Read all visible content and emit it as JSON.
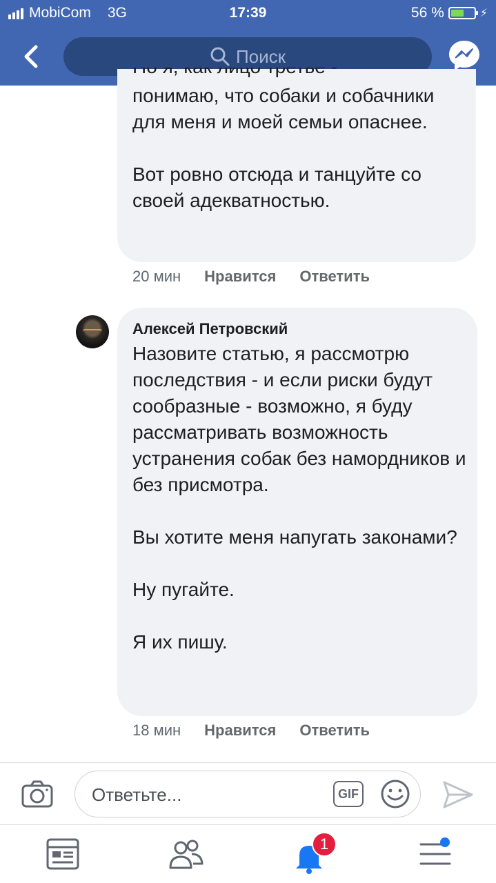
{
  "status_bar": {
    "carrier": "MobiCom",
    "network": "3G",
    "time": "17:39",
    "battery_text": "56 %",
    "battery_level": 0.56
  },
  "header": {
    "search_placeholder": "Поиск",
    "accent_color": "#4267b2"
  },
  "comments": [
    {
      "author": "",
      "cut_line": "Но я, как лицо третье -",
      "paragraphs": [
        "понимаю, что собаки и собачники для меня и моей семьи опаснее.",
        "Вот ровно отсюда и танцуйте со своей адекватностью."
      ],
      "time": "20 мин",
      "like_label": "Нравится",
      "reply_label": "Ответить"
    },
    {
      "author": "Алексей Петровский",
      "paragraphs": [
        "Назовите статью, я рассмотрю последствия - и если риски будут сообразные - возможно, я буду рассматривать возможность устранения собак без намордников и без присмотра.",
        "Вы хотите меня напугать законами?",
        "Ну пугайте.",
        "Я их пишу."
      ],
      "time": "18 мин",
      "like_label": "Нравится",
      "reply_label": "Ответить"
    }
  ],
  "composer": {
    "placeholder": "Ответьте...",
    "gif_label": "GIF"
  },
  "tabbar": {
    "notification_count": "1",
    "icons": [
      "news-feed-icon",
      "friends-icon",
      "notifications-icon",
      "menu-icon"
    ]
  }
}
